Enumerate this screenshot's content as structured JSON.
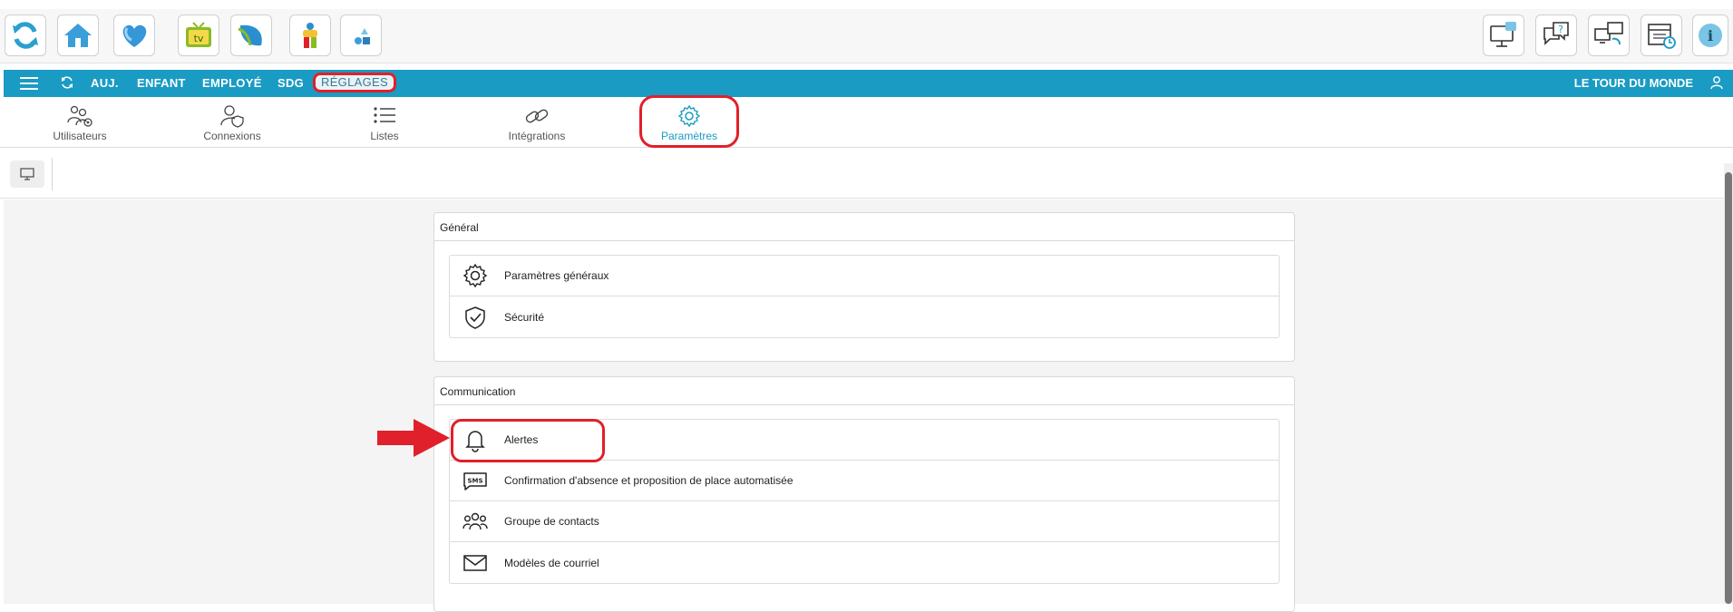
{
  "launcher": {
    "left_apps": [
      "refresh-app-icon",
      "home-app-icon",
      "heart-app-icon",
      "tv-app-icon",
      "leaf-app-icon",
      "person-app-icon",
      "shapes-app-icon"
    ],
    "tv_label": "tv",
    "right_apps": [
      "training-monitor-icon",
      "help-chat-icon",
      "sync-screens-icon",
      "calendar-clock-icon"
    ],
    "info_label": "i"
  },
  "navbar": {
    "links": [
      "AUJ.",
      "ENFANT",
      "EMPLOYÉ",
      "SDG",
      "RÉGLAGES"
    ],
    "active": "RÉGLAGES",
    "organization": "LE TOUR DU MONDE"
  },
  "subtabs": [
    {
      "label": "Utilisateurs",
      "icon": "users-gear-icon"
    },
    {
      "label": "Connexions",
      "icon": "user-shield-icon"
    },
    {
      "label": "Listes",
      "icon": "list-icon"
    },
    {
      "label": "Intégrations",
      "icon": "link-icon"
    },
    {
      "label": "Paramètres",
      "icon": "gear-icon",
      "active": true
    }
  ],
  "sections": {
    "general": {
      "title": "Général",
      "items": [
        {
          "label": "Paramètres généraux",
          "icon": "gear-icon"
        },
        {
          "label": "Sécurité",
          "icon": "shield-check-icon"
        }
      ]
    },
    "communication": {
      "title": "Communication",
      "items": [
        {
          "label": "Alertes",
          "icon": "bell-icon"
        },
        {
          "label": "Confirmation d'absence et proposition de place automatisée",
          "icon": "sms-icon"
        },
        {
          "label": "Groupe de contacts",
          "icon": "group-icon"
        },
        {
          "label": "Modèles de courriel",
          "icon": "envelope-icon"
        }
      ]
    }
  },
  "colors": {
    "accent": "#1a9bc3",
    "highlight": "#e0202a"
  }
}
